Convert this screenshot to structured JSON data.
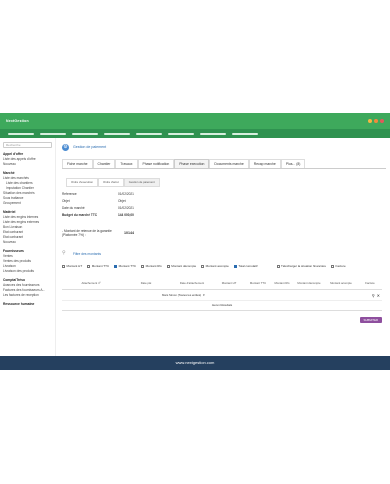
{
  "app": {
    "logo": "NextGestion"
  },
  "window_dots": [
    "#f5b642",
    "#f08a3c",
    "#e05a5a"
  ],
  "sidebar": {
    "search_placeholder": "Recherche",
    "sections": [
      {
        "title": "Appel d'offre",
        "items": [
          {
            "label": "Liste des appels d'offre",
            "sub": false
          },
          {
            "label": "Nouveau",
            "sub": false
          }
        ]
      },
      {
        "title": "Marché",
        "items": [
          {
            "label": "Liste des marchés",
            "sub": false
          },
          {
            "label": "Liste des chantiers",
            "sub": true
          },
          {
            "label": "Imputation Chantier",
            "sub": true
          },
          {
            "label": "Situation des marchés",
            "sub": false
          },
          {
            "label": "Sous traitance",
            "sub": false
          },
          {
            "label": "Groupement",
            "sub": false
          }
        ]
      },
      {
        "title": "Matériel",
        "items": [
          {
            "label": "Liste des engins internes",
            "sub": false
          },
          {
            "label": "Liste des engins externes",
            "sub": false
          },
          {
            "label": "Bon Livraison",
            "sub": false
          },
          {
            "label": "Etat carburant",
            "sub": false
          },
          {
            "label": "Etat carburant",
            "sub": false
          },
          {
            "label": "Nouveau",
            "sub": false
          }
        ]
      },
      {
        "title": "Fournisseurs",
        "items": [
          {
            "label": "Ventes",
            "sub": false
          },
          {
            "label": "Ventes des produits",
            "sub": false
          },
          {
            "label": "Livraison",
            "sub": false
          },
          {
            "label": "Livraison des produits",
            "sub": false
          }
        ]
      },
      {
        "title": "Compta/Tréso",
        "items": [
          {
            "label": "Avances des fournisseurs",
            "sub": false
          },
          {
            "label": "Factures des fournisseurs A...",
            "sub": false
          },
          {
            "label": "Les factures de reception",
            "sub": false
          }
        ]
      },
      {
        "title": "Ressource humaine",
        "items": []
      }
    ]
  },
  "main": {
    "title": "Gestion de paiement",
    "tabs": [
      {
        "label": "Fiche marche",
        "active": false
      },
      {
        "label": "Chantier",
        "active": false
      },
      {
        "label": "Travaux",
        "active": false
      },
      {
        "label": "Phase notification",
        "active": false
      },
      {
        "label": "Phase execution",
        "active": true
      },
      {
        "label": "Documents marche",
        "active": false
      },
      {
        "label": "Recap marche",
        "active": false
      },
      {
        "label": "Plus... (8)",
        "active": false
      }
    ],
    "subtabs": [
      {
        "label": "Ordre d'execution",
        "active": false
      },
      {
        "label": "Ordre d'arret",
        "active": false
      },
      {
        "label": "Gestion de paiement",
        "active": true
      }
    ],
    "info": [
      {
        "key": "Reference",
        "value": "01/02/2021",
        "bold": false
      },
      {
        "key": "Objet",
        "value": "Objet",
        "bold": false
      },
      {
        "key": "Date du marché",
        "value": "01/02/2021",
        "bold": false
      },
      {
        "key": "Budget du marché TTC",
        "value": "144 000,00",
        "bold": true
      }
    ],
    "retenue": {
      "label": "- Montant de retenue de la garantie (Plafonnée 7%) :",
      "value": "10144"
    },
    "filter_title": "Filtre des montants",
    "filters": [
      {
        "label": "Montant HT",
        "checked": false
      },
      {
        "label": "Montant TTC",
        "checked": false
      },
      {
        "label": "Montant TTC",
        "checked": true
      },
      {
        "label": "Montant RG",
        "checked": false
      },
      {
        "label": "Montant décompte",
        "checked": false
      },
      {
        "label": "Montant acompte",
        "checked": false
      },
      {
        "label": "Total cumulatif",
        "checked": true
      },
      {
        "label": "Facture",
        "checked": false
      }
    ],
    "download_label": "Télécharger la situation financière",
    "table": {
      "headers": [
        "Attachement nº",
        "Date pài",
        "Date d'attachement",
        "Montant HT",
        "Montant TTC",
        "Montant RG",
        "Montant décompte",
        "Montant acompte",
        "Facture"
      ],
      "filter_select": "Mars Simon (Toutes les entités)",
      "empty_text": "Aucun Résultats"
    },
    "submit_label": "SUBMITER"
  },
  "footer": {
    "url": "www.nextgestion.com"
  }
}
